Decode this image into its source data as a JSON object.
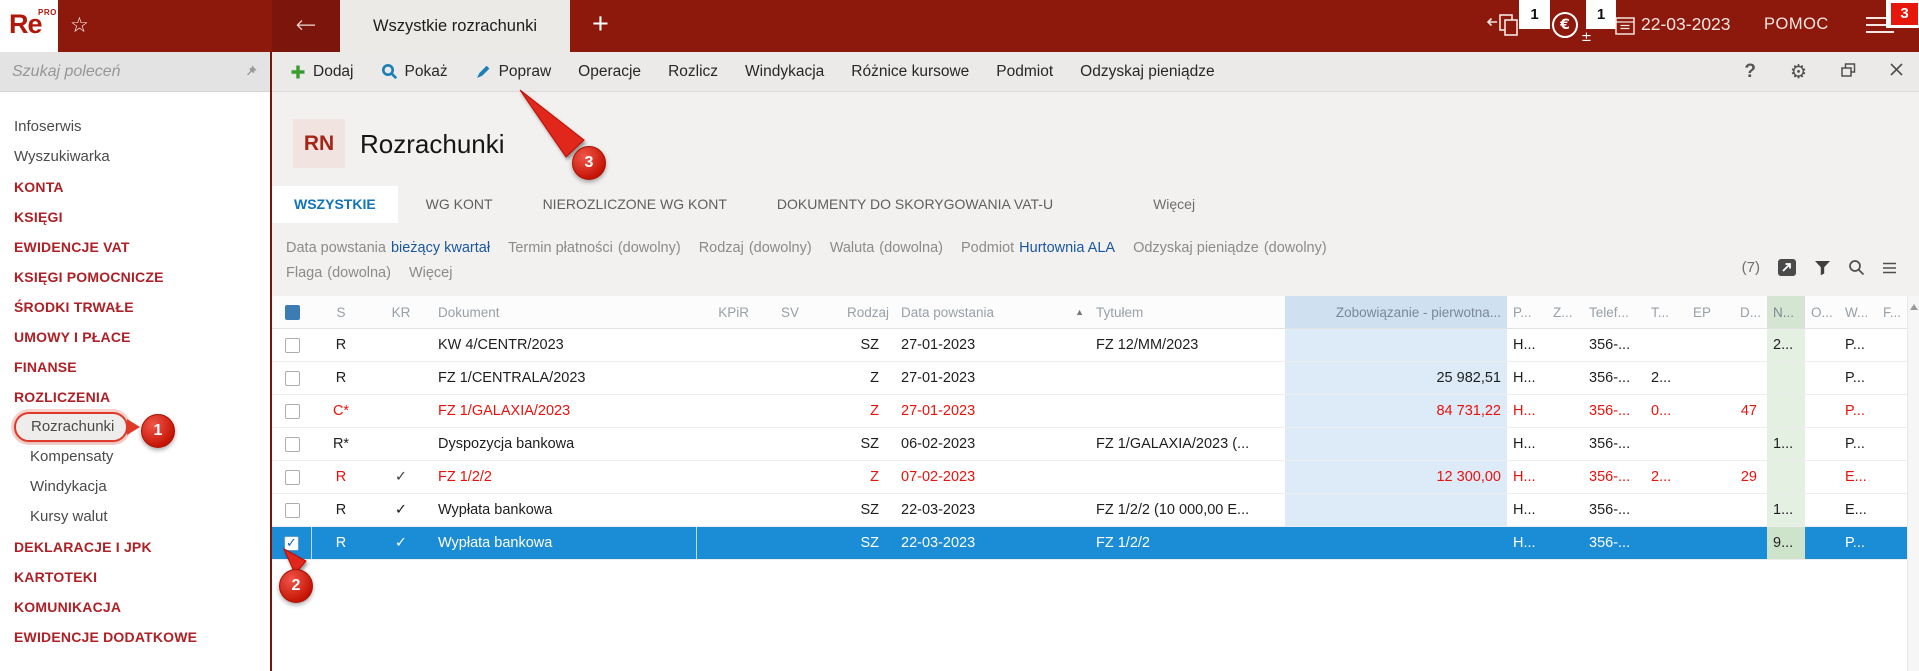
{
  "colors": {
    "topbar_red": "#8c190c",
    "topbar_dark_red": "#7c150b",
    "brand_red": "#b3170a",
    "category_red": "#ae2025",
    "annotation_red": "#e1251b",
    "selection_blue": "#1b8cd6",
    "active_tab_blue": "#1273b8",
    "filter_value_blue": "#19579e",
    "red_row_text": "#e8120c",
    "column_blue_header": "#cfe1f0",
    "column_blue_cell": "#dcebf7",
    "column_green_header": "#d4e6d2",
    "column_green_cell": "#e4f0e2",
    "toolbar_green": "#3a9b2f",
    "toolbar_blue": "#1b7fb5",
    "badge_red": "#e8170b"
  },
  "topbar": {
    "logo": "Re",
    "logo_sup": "PRO",
    "tab_title": "Wszystkie rozrachunki",
    "badge_documents": "1",
    "badge_currency": "1",
    "currency_glyph": "€",
    "plus_minus_glyph": "±",
    "date": "22-03-2023",
    "help": "POMOC",
    "badge_menu": "3"
  },
  "sidebar": {
    "search_placeholder": "Szukaj poleceń",
    "items": [
      {
        "label": "Infoserwis",
        "kind": "item"
      },
      {
        "label": "Wyszukiwarka",
        "kind": "item"
      },
      {
        "label": "KONTA",
        "kind": "category"
      },
      {
        "label": "KSIĘGI",
        "kind": "category"
      },
      {
        "label": "EWIDENCJE VAT",
        "kind": "category"
      },
      {
        "label": "KSIĘGI POMOCNICZE",
        "kind": "category"
      },
      {
        "label": "ŚRODKI TRWAŁE",
        "kind": "category"
      },
      {
        "label": "UMOWY I PŁACE",
        "kind": "category"
      },
      {
        "label": "FINANSE",
        "kind": "category"
      },
      {
        "label": "ROZLICZENIA",
        "kind": "category"
      },
      {
        "label": "Rozrachunki",
        "kind": "subitem",
        "active": true
      },
      {
        "label": "Kompensaty",
        "kind": "subitem"
      },
      {
        "label": "Windykacja",
        "kind": "subitem"
      },
      {
        "label": "Kursy walut",
        "kind": "subitem"
      },
      {
        "label": "DEKLARACJE I JPK",
        "kind": "category"
      },
      {
        "label": "KARTOTEKI",
        "kind": "category"
      },
      {
        "label": "KOMUNIKACJA",
        "kind": "category"
      },
      {
        "label": "EWIDENCJE DODATKOWE",
        "kind": "category"
      }
    ]
  },
  "toolbar": {
    "buttons": [
      {
        "label": "Dodaj",
        "icon": "plus-icon"
      },
      {
        "label": "Pokaż",
        "icon": "search-icon"
      },
      {
        "label": "Popraw",
        "icon": "pencil-icon"
      },
      {
        "label": "Operacje"
      },
      {
        "label": "Rozlicz"
      },
      {
        "label": "Windykacja"
      },
      {
        "label": "Różnice kursowe"
      },
      {
        "label": "Podmiot"
      },
      {
        "label": "Odzyskaj pieniądze"
      }
    ],
    "help": "?"
  },
  "page": {
    "module_code": "RN",
    "title": "Rozrachunki"
  },
  "tabs": [
    {
      "label": "WSZYSTKIE",
      "active": true
    },
    {
      "label": "WG KONT"
    },
    {
      "label": "NIEROZLICZONE WG KONT"
    },
    {
      "label": "DOKUMENTY DO SKORYGOWANIA VAT-U"
    },
    {
      "label": "Więcej",
      "more": true
    }
  ],
  "filters": {
    "row1": [
      {
        "label": "Data powstania",
        "value": "bieżący kwartał",
        "set": true
      },
      {
        "label": "Termin płatności",
        "value": "(dowolny)",
        "set": false
      },
      {
        "label": "Rodzaj",
        "value": "(dowolny)",
        "set": false
      },
      {
        "label": "Waluta",
        "value": "(dowolna)",
        "set": false
      },
      {
        "label": "Podmiot",
        "value": "Hurtownia ALA",
        "set": true
      },
      {
        "label": "Odzyskaj pieniądze",
        "value": "(dowolny)",
        "set": false
      }
    ],
    "row2": [
      {
        "label": "Flaga",
        "value": "(dowolna)",
        "set": false
      },
      {
        "label": "Więcej",
        "value": "",
        "set": false
      }
    ],
    "count": "(7)"
  },
  "table": {
    "columns": [
      {
        "key": "check",
        "label": ""
      },
      {
        "key": "s",
        "label": "S"
      },
      {
        "key": "kr",
        "label": "KR"
      },
      {
        "key": "dokument",
        "label": "Dokument"
      },
      {
        "key": "kpir",
        "label": "KPiR"
      },
      {
        "key": "sv",
        "label": "SV"
      },
      {
        "key": "rodzaj",
        "label": "Rodzaj"
      },
      {
        "key": "data",
        "label": "Data powstania",
        "sorted": "asc"
      },
      {
        "key": "tytulem",
        "label": "Tytułem"
      },
      {
        "key": "zobowiazanie",
        "label": "Zobowiązanie - pierwotna...",
        "highlight": "blue"
      },
      {
        "key": "p",
        "label": "P..."
      },
      {
        "key": "z",
        "label": "Z..."
      },
      {
        "key": "telef",
        "label": "Telef..."
      },
      {
        "key": "t",
        "label": "T..."
      },
      {
        "key": "ep",
        "label": "EP"
      },
      {
        "key": "d",
        "label": "D..."
      },
      {
        "key": "n",
        "label": "N...",
        "highlight": "green"
      },
      {
        "key": "o",
        "label": "O..."
      },
      {
        "key": "w",
        "label": "W..."
      },
      {
        "key": "f",
        "label": "F..."
      }
    ],
    "rows": [
      {
        "s": "R",
        "dokument": "KW 4/CENTR/2023",
        "rodzaj": "SZ",
        "data": "27-01-2023",
        "tytulem": "FZ 12/MM/2023",
        "p": "H...",
        "telef": "356-...",
        "n": "2...",
        "w": "P..."
      },
      {
        "s": "R",
        "dokument": "FZ 1/CENTRALA/2023",
        "rodzaj": "Z",
        "data": "27-01-2023",
        "zobowiazanie": "25 982,51",
        "p": "H...",
        "telef": "356-...",
        "t": "2...",
        "w": "P..."
      },
      {
        "s": "C*",
        "dokument": "FZ 1/GALAXIA/2023",
        "rodzaj": "Z",
        "data": "27-01-2023",
        "zobowiazanie": "84 731,22",
        "p": "H...",
        "telef": "356-...",
        "t": "0...",
        "d": "47",
        "w": "P...",
        "red": true
      },
      {
        "s": "R*",
        "dokument": "Dyspozycja bankowa",
        "rodzaj": "SZ",
        "data": "06-02-2023",
        "tytulem": "FZ 1/GALAXIA/2023 (...",
        "p": "H...",
        "telef": "356-...",
        "n": "1...",
        "w": "P..."
      },
      {
        "s": "R",
        "kr": "✓",
        "dokument": "FZ 1/2/2",
        "rodzaj": "Z",
        "data": "07-02-2023",
        "zobowiazanie": "12 300,00",
        "p": "H...",
        "telef": "356-...",
        "t": "2...",
        "d": "29",
        "w": "E...",
        "red": true
      },
      {
        "s": "R",
        "kr": "✓",
        "dokument": "Wypłata bankowa",
        "rodzaj": "SZ",
        "data": "22-03-2023",
        "tytulem": "FZ 1/2/2 (10 000,00 E...",
        "p": "H...",
        "telef": "356-...",
        "n": "1...",
        "w": "E..."
      },
      {
        "s": "R",
        "kr": "✓",
        "dokument": "Wypłata bankowa",
        "rodzaj": "SZ",
        "data": "22-03-2023",
        "tytulem": "FZ 1/2/2",
        "p": "H...",
        "telef": "356-...",
        "n": "9...",
        "w": "P...",
        "selected": true,
        "checked": true
      }
    ]
  },
  "annotations": [
    {
      "number": "1"
    },
    {
      "number": "2"
    },
    {
      "number": "3"
    }
  ]
}
